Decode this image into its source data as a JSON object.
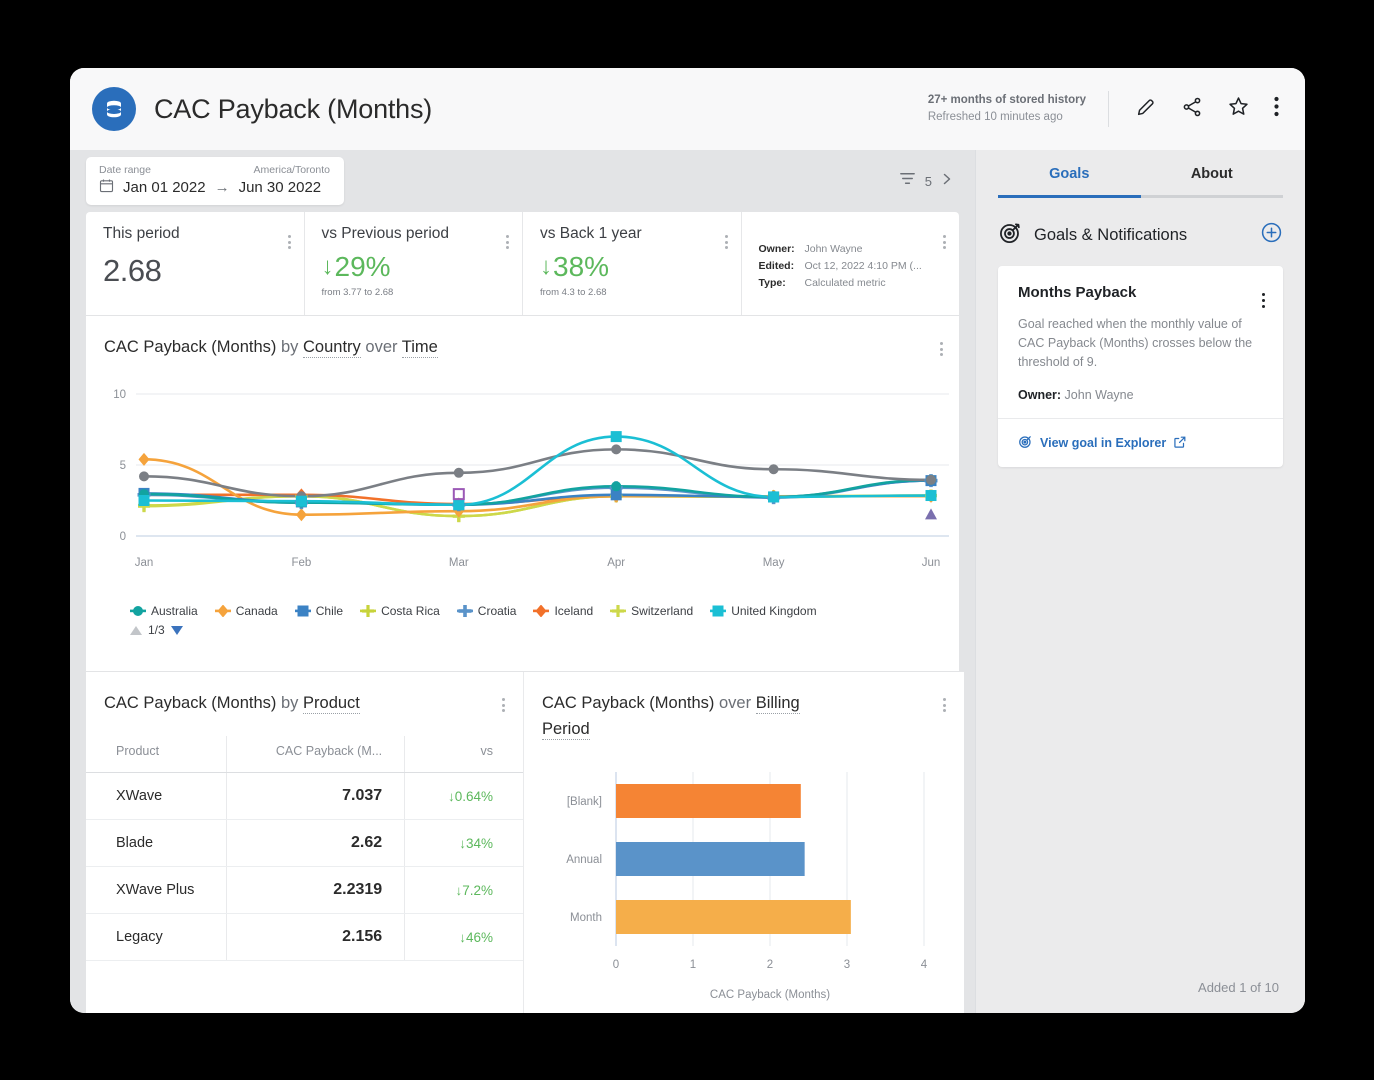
{
  "header": {
    "title": "CAC Payback (Months)",
    "history": "27+ months of stored history",
    "refreshed": "Refreshed 10 minutes ago",
    "icons": [
      "edit-pencil-icon",
      "share-icon",
      "star-icon",
      "overflow-menu-icon"
    ]
  },
  "filterbar": {
    "date_range_label": "Date range",
    "timezone": "America/Toronto",
    "start_date": "Jan 01 2022",
    "end_date": "Jun 30 2022",
    "arrow": "→",
    "filter_count": "5"
  },
  "kpis": [
    {
      "label": "This period",
      "value": "2.68"
    },
    {
      "label": "vs Previous period",
      "arrow": "↓",
      "delta": "29%",
      "sub": "from 3.77 to 2.68"
    },
    {
      "label": "vs Back 1 year",
      "arrow": "↓",
      "delta": "38%",
      "sub": "from 4.3 to 2.68"
    }
  ],
  "meta": {
    "owner_key": "Owner:",
    "owner_val": "John Wayne",
    "edited_key": "Edited:",
    "edited_val": "Oct 12, 2022 4:10 PM (...",
    "type_key": "Type:",
    "type_val": "Calculated metric"
  },
  "line_card": {
    "title_metric": "CAC Payback (Months)",
    "by": "by",
    "dimension": "Country",
    "over": "over",
    "time": "Time",
    "pager": "1/3"
  },
  "product_card": {
    "title_metric": "CAC Payback (Months)",
    "by": "by",
    "dimension": "Product"
  },
  "billing_card": {
    "title_metric": "CAC Payback (Months)",
    "over": "over",
    "dimension": "Billing Period"
  },
  "sidebar": {
    "tabs": [
      {
        "label": "Goals",
        "active": true
      },
      {
        "label": "About",
        "active": false
      }
    ],
    "section_title": "Goals & Notifications",
    "goal": {
      "title": "Months Payback",
      "description": "Goal reached when the monthly value of CAC Payback (Months) crosses below the threshold of 9.",
      "owner_key": "Owner:",
      "owner_val": "John Wayne",
      "link": "View goal in Explorer"
    },
    "added": "Added 1 of 10"
  },
  "colors": {
    "brand_blue": "#2a6ebb",
    "green": "#5cb85c",
    "orange": "#f5a33c",
    "teal": "#17a2b8"
  },
  "chart_data": [
    {
      "type": "line",
      "title": "CAC Payback (Months) by Country over Time",
      "xlabel": "",
      "ylabel": "",
      "categories": [
        "Jan",
        "Feb",
        "Mar",
        "Apr",
        "May",
        "Jun"
      ],
      "ylim": [
        0,
        10
      ],
      "yticks": [
        0,
        5,
        10
      ],
      "grid": true,
      "legend_position": "bottom",
      "series": [
        {
          "name": "Australia",
          "color": "#12a3a0",
          "marker": "circle",
          "values": [
            2.95,
            2.35,
            2.2,
            3.5,
            2.75,
            3.95
          ]
        },
        {
          "name": "Canada",
          "color": "#f5a33c",
          "marker": "diamond",
          "values": [
            5.4,
            1.5,
            1.75,
            2.8,
            2.8,
            2.8
          ]
        },
        {
          "name": "Chile",
          "color": "#3b82c4",
          "marker": "square",
          "values": [
            3.0,
            2.4,
            2.2,
            2.9,
            2.75,
            3.9
          ]
        },
        {
          "name": "Costa Rica",
          "color": "#c7d33a",
          "marker": "star",
          "values": [
            2.15,
            2.8,
            1.4,
            2.8,
            2.75,
            2.85
          ]
        },
        {
          "name": "Croatia",
          "color": "#5a93c9",
          "marker": "cross",
          "values": [
            2.9,
            2.35,
            2.2,
            3.4,
            2.7,
            3.9
          ]
        },
        {
          "name": "Iceland",
          "color": "#f2712a",
          "marker": "diamond",
          "values": [
            2.9,
            2.9,
            2.25,
            2.8,
            2.8,
            2.8
          ]
        },
        {
          "name": "Switzerland",
          "color": "#cdd84a",
          "marker": "star",
          "values": [
            2.1,
            2.8,
            1.4,
            2.8,
            2.8,
            2.85
          ]
        },
        {
          "name": "United Kingdom",
          "color": "#1bbfd4",
          "marker": "square",
          "values": [
            2.5,
            2.45,
            2.2,
            7.0,
            2.75,
            2.85
          ]
        },
        {
          "name": "(gray series)",
          "color": "#7b7f85",
          "marker": "circle",
          "values": [
            4.2,
            2.8,
            4.45,
            6.1,
            4.7,
            3.95
          ]
        }
      ]
    },
    {
      "type": "bar",
      "orientation": "horizontal",
      "title": "CAC Payback (Months) over Billing Period",
      "xlabel": "CAC Payback (Months)",
      "ylabel": "",
      "categories": [
        "[Blank]",
        "Annual",
        "Month"
      ],
      "values": [
        2.4,
        2.45,
        3.05
      ],
      "colors": [
        "#f58434",
        "#5a93c9",
        "#f5ae4a"
      ],
      "xlim": [
        0,
        4
      ],
      "xticks": [
        0,
        1,
        2,
        3,
        4
      ],
      "grid": true
    },
    {
      "type": "table",
      "title": "CAC Payback (Months) by Product",
      "columns": [
        "Product",
        "CAC Payback (M...",
        "vs"
      ],
      "rows": [
        {
          "product": "XWave",
          "value": "7.037",
          "vs": "↓0.64%"
        },
        {
          "product": "Blade",
          "value": "2.62",
          "vs": "↓34%"
        },
        {
          "product": "XWave Plus",
          "value": "2.2319",
          "vs": "↓7.2%"
        },
        {
          "product": "Legacy",
          "value": "2.156",
          "vs": "↓46%"
        }
      ]
    }
  ]
}
